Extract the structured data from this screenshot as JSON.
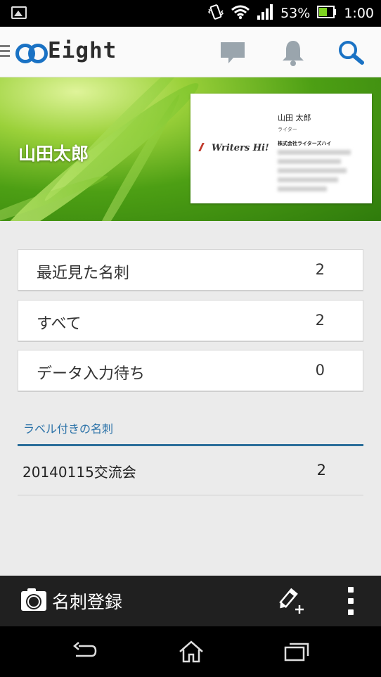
{
  "status_bar": {
    "battery_percent": "53%",
    "time": "1:00",
    "icons": [
      "image-notification-icon",
      "vibrate-icon",
      "wifi-icon",
      "signal-icon",
      "battery-icon"
    ]
  },
  "app_bar": {
    "app_name": "Eight",
    "actions": [
      "message-icon",
      "bell-icon",
      "search-icon"
    ]
  },
  "profile": {
    "name": "山田太郎",
    "business_card": {
      "brand": "Writers Hi!",
      "person_name": "山田 太郎",
      "role": "ライター",
      "company": "株式会社ライターズハイ"
    }
  },
  "lists": [
    {
      "label": "最近見た名刺",
      "count": "2"
    },
    {
      "label": "すべて",
      "count": "2"
    },
    {
      "label": "データ入力待ち",
      "count": "0"
    }
  ],
  "labels_section": {
    "title": "ラベル付きの名刺",
    "items": [
      {
        "label": "20140115交流会",
        "count": "2"
      }
    ]
  },
  "action_bar": {
    "scan_label": "名刺登録",
    "icons": [
      "camera-icon",
      "edit-add-icon",
      "more-icon"
    ]
  },
  "nav_bar": {
    "icons": [
      "back-icon",
      "home-icon",
      "recents-icon"
    ]
  },
  "colors": {
    "accent": "#1a72c4",
    "section_head": "#2b72a8",
    "content_bg": "#ebebeb",
    "action_bar_bg": "#202020"
  }
}
